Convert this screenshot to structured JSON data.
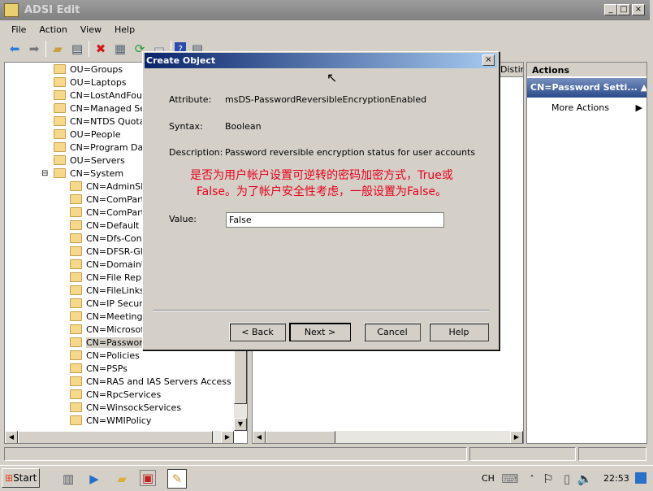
{
  "window": {
    "title": "ADSI Edit",
    "min": "_",
    "max": "□",
    "close": "×"
  },
  "menu": [
    "File",
    "Action",
    "View",
    "Help"
  ],
  "toolbar": [
    "back-icon",
    "forward-icon",
    "up-icon",
    "show-hide-tree-icon",
    "delete-icon",
    "properties-icon",
    "refresh-icon",
    "export-icon",
    "help-icon",
    "console-icon"
  ],
  "tree": {
    "items": [
      {
        "label": "OU=Groups",
        "level": 1
      },
      {
        "label": "OU=Laptops",
        "level": 1
      },
      {
        "label": "CN=LostAndFound",
        "level": 1
      },
      {
        "label": "CN=Managed Serv",
        "level": 1
      },
      {
        "label": "CN=NTDS Quotas",
        "level": 1
      },
      {
        "label": "OU=People",
        "level": 1
      },
      {
        "label": "CN=Program Data",
        "level": 1
      },
      {
        "label": "OU=Servers",
        "level": 1
      },
      {
        "label": "CN=System",
        "level": 1,
        "expanded": true
      },
      {
        "label": "CN=AdminSDH",
        "level": 2
      },
      {
        "label": "CN=ComPartit",
        "level": 2
      },
      {
        "label": "CN=ComPartit",
        "level": 2
      },
      {
        "label": "CN=Default D",
        "level": 2
      },
      {
        "label": "CN=Dfs-Confi",
        "level": 2
      },
      {
        "label": "CN=DFSR-Glob",
        "level": 2
      },
      {
        "label": "CN=DomainUp",
        "level": 2
      },
      {
        "label": "CN=File Replic",
        "level": 2
      },
      {
        "label": "CN=FileLinks",
        "level": 2
      },
      {
        "label": "CN=IP Securit",
        "level": 2
      },
      {
        "label": "CN=Meetings",
        "level": 2
      },
      {
        "label": "CN=Microsoft",
        "level": 2
      },
      {
        "label": "CN=Password",
        "level": 2,
        "selected": true
      },
      {
        "label": "CN=Policies",
        "level": 2
      },
      {
        "label": "CN=PSPs",
        "level": 2
      },
      {
        "label": "CN=RAS and IAS Servers Access Che",
        "level": 2
      },
      {
        "label": "CN=RpcServices",
        "level": 2
      },
      {
        "label": "CN=WinsockServices",
        "level": 2
      },
      {
        "label": "CN=WMIPolicy",
        "level": 2
      }
    ]
  },
  "list": {
    "column": "Distin"
  },
  "actions": {
    "header": "Actions",
    "section": "CN=Password Setti...",
    "more": "More Actions"
  },
  "dialog": {
    "title": "Create Object",
    "attribute_label": "Attribute:",
    "attribute": "msDS-PasswordReversibleEncryptionEnabled",
    "syntax_label": "Syntax:",
    "syntax": "Boolean",
    "description_label": "Description:",
    "description": "Password reversible encryption status for user accounts",
    "annotation_line1": "是否为用户帐户设置可逆转的密码加密方式，True或",
    "annotation_line2": "False。为了帐户安全性考虑，一般设置为False。",
    "value_label": "Value:",
    "value": "False",
    "back": "< Back",
    "next": "Next >",
    "cancel": "Cancel",
    "help": "Help"
  },
  "taskbar": {
    "start": "Start",
    "lang": "CH",
    "clock": "22:53"
  },
  "colors": {
    "annotation": "#e8001c",
    "dialog_title": "#0a246a",
    "actions_header": "#4a6aa0"
  }
}
